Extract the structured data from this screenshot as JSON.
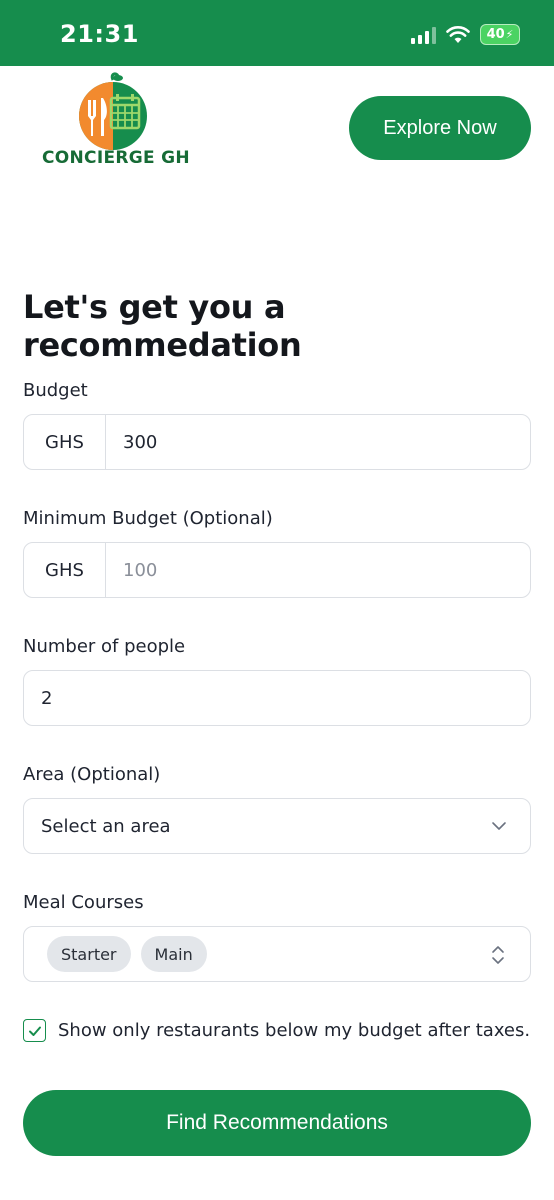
{
  "status_bar": {
    "time": "21:31",
    "battery": "40"
  },
  "header": {
    "logo_text": "CONCIERGE GH",
    "explore_label": "Explore Now"
  },
  "page": {
    "title": "Let's get you a recommedation"
  },
  "form": {
    "budget": {
      "label": "Budget",
      "currency": "GHS",
      "value": "300"
    },
    "min_budget": {
      "label": "Minimum Budget (Optional)",
      "currency": "GHS",
      "placeholder": "100"
    },
    "people": {
      "label": "Number of people",
      "value": "2"
    },
    "area": {
      "label": "Area (Optional)",
      "placeholder": "Select an area"
    },
    "courses": {
      "label": "Meal Courses",
      "selected": [
        "Starter",
        "Main"
      ]
    },
    "below_budget": {
      "label": "Show only restaurants below my budget after taxes.",
      "checked": true
    },
    "submit_label": "Find Recommendations"
  },
  "colors": {
    "brand": "#168d4d",
    "logo_orange": "#f28a2e"
  }
}
